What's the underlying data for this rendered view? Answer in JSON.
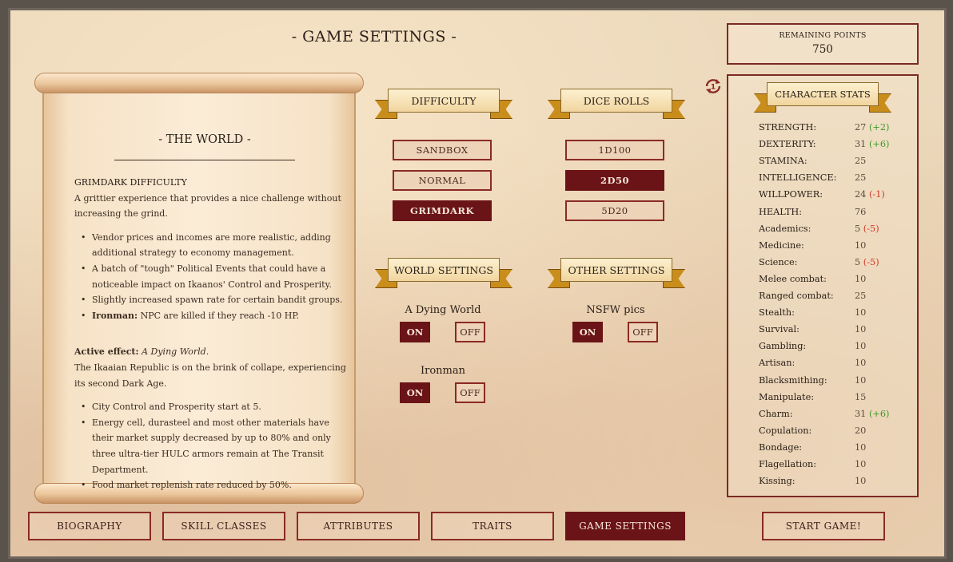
{
  "page_title": "- GAME SETTINGS -",
  "world_panel": {
    "title": "- THE WORLD -",
    "difficulty_heading": "GRIMDARK DIFFICULTY",
    "difficulty_desc": "A grittier experience that provides a nice challenge without increasing the grind.",
    "difficulty_bullets": [
      "Vendor prices and incomes are more realistic, adding additional strategy to economy management.",
      "A batch of \"tough\" Political Events that could have a noticeable impact on Ikaanos' Control and Prosperity.",
      "Slightly increased spawn rate for certain bandit groups.",
      "NPC are killed if they reach -10 HP."
    ],
    "ironman_bold": "Ironman:",
    "active_label": "Active effect:",
    "active_value": "A Dying World.",
    "active_desc": "The Ikaaian Republic is on the brink of collape, experiencing its second Dark Age.",
    "active_bullets": [
      "City Control and Prosperity start at 5.",
      "Energy cell, durasteel and most other materials have their market supply decreased by up to 80% and only three ultra-tier HULC armors remain at The Transit Department.",
      "Food market replenish rate reduced by 50%."
    ]
  },
  "difficulty": {
    "label": "DIFFICULTY",
    "options": [
      "SANDBOX",
      "NORMAL",
      "GRIMDARK"
    ],
    "selected": "GRIMDARK"
  },
  "dice_rolls": {
    "label": "DICE ROLLS",
    "options": [
      "1D100",
      "2D50",
      "5D20"
    ],
    "selected": "2D50"
  },
  "world_settings": {
    "label": "WORLD SETTINGS",
    "dying_world": {
      "label": "A Dying World",
      "on": "ON",
      "off": "OFF",
      "value": "ON"
    },
    "ironman": {
      "label": "Ironman",
      "on": "ON",
      "off": "OFF",
      "value": "ON"
    }
  },
  "other_settings": {
    "label": "OTHER SETTINGS",
    "nsfw": {
      "label": "NSFW pics",
      "on": "ON",
      "off": "OFF",
      "value": "ON"
    }
  },
  "remaining_points": {
    "label": "REMAINING POINTS",
    "value": "750"
  },
  "reset_icon": "reset-cycle-icon",
  "character_stats": {
    "label": "CHARACTER STATS",
    "stats": [
      {
        "name": "STRENGTH:",
        "value": "27",
        "mod": "(+2)",
        "mod_type": "pos"
      },
      {
        "name": "DEXTERITY:",
        "value": "31",
        "mod": "(+6)",
        "mod_type": "pos"
      },
      {
        "name": "STAMINA:",
        "value": "25",
        "mod": "",
        "mod_type": ""
      },
      {
        "name": "INTELLIGENCE:",
        "value": "25",
        "mod": "",
        "mod_type": ""
      },
      {
        "name": "WILLPOWER:",
        "value": "24",
        "mod": "(-1)",
        "mod_type": "neg"
      },
      {
        "name": "HEALTH:",
        "value": "76",
        "mod": "",
        "mod_type": ""
      },
      {
        "name": "Academics:",
        "value": "5",
        "mod": "(-5)",
        "mod_type": "neg"
      },
      {
        "name": "Medicine:",
        "value": "10",
        "mod": "",
        "mod_type": ""
      },
      {
        "name": "Science:",
        "value": "5",
        "mod": "(-5)",
        "mod_type": "neg"
      },
      {
        "name": "Melee combat:",
        "value": "10",
        "mod": "",
        "mod_type": ""
      },
      {
        "name": "Ranged combat:",
        "value": "25",
        "mod": "",
        "mod_type": ""
      },
      {
        "name": "Stealth:",
        "value": "10",
        "mod": "",
        "mod_type": ""
      },
      {
        "name": "Survival:",
        "value": "10",
        "mod": "",
        "mod_type": ""
      },
      {
        "name": "Gambling:",
        "value": "10",
        "mod": "",
        "mod_type": ""
      },
      {
        "name": "Artisan:",
        "value": "10",
        "mod": "",
        "mod_type": ""
      },
      {
        "name": "Blacksmithing:",
        "value": "10",
        "mod": "",
        "mod_type": ""
      },
      {
        "name": "Manipulate:",
        "value": "15",
        "mod": "",
        "mod_type": ""
      },
      {
        "name": "Charm:",
        "value": "31",
        "mod": "(+6)",
        "mod_type": "pos"
      },
      {
        "name": "Copulation:",
        "value": "20",
        "mod": "",
        "mod_type": ""
      },
      {
        "name": "Bondage:",
        "value": "10",
        "mod": "",
        "mod_type": ""
      },
      {
        "name": "Flagellation:",
        "value": "10",
        "mod": "",
        "mod_type": ""
      },
      {
        "name": "Kissing:",
        "value": "10",
        "mod": "",
        "mod_type": ""
      }
    ]
  },
  "tabs": [
    "BIOGRAPHY",
    "SKILL CLASSES",
    "ATTRIBUTES",
    "TRAITS",
    "GAME SETTINGS"
  ],
  "active_tab": "GAME SETTINGS",
  "start_button": "START GAME!",
  "colors": {
    "accent": "#6b1418",
    "border": "#8a2a24",
    "ribbon_gold": "#c98d1b",
    "parchment": "#ecd9bc",
    "mod_positive": "#3e9a2a",
    "mod_negative": "#d23a2a"
  }
}
